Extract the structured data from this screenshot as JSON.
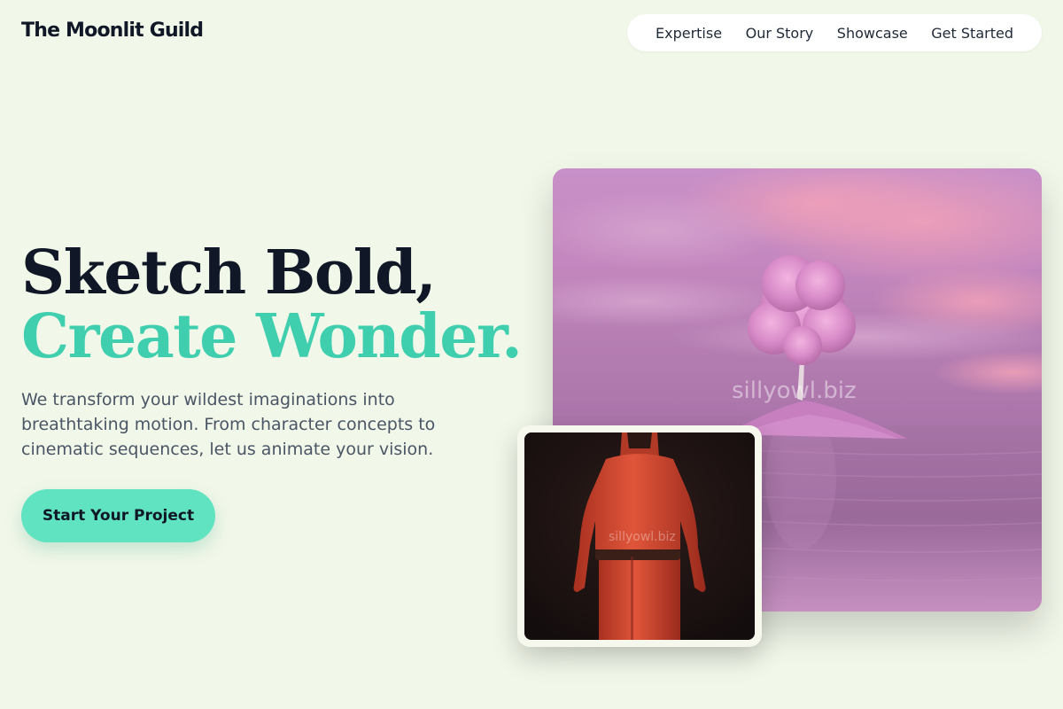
{
  "brand": {
    "name": "The Moonlit Guild"
  },
  "nav": {
    "items": [
      {
        "label": "Expertise"
      },
      {
        "label": "Our Story"
      },
      {
        "label": "Showcase"
      },
      {
        "label": "Get Started"
      }
    ]
  },
  "hero": {
    "line1": "Sketch Bold,",
    "line2": "Create Wonder.",
    "description": "We transform your wildest imaginations into breathtaking motion. From character concepts to cinematic sequences, let us animate your vision.",
    "cta_label": "Start Your Project"
  },
  "images": {
    "main": {
      "watermark": "sillyowl.biz"
    },
    "secondary": {
      "watermark": "sillyowl.biz"
    }
  },
  "colors": {
    "background": "#f1f7e9",
    "accent_text": "#40cfae",
    "cta_bg": "#5fe3c0",
    "dark_text": "#101726"
  }
}
